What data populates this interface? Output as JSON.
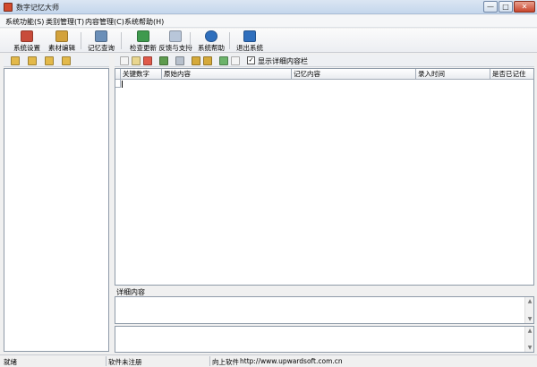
{
  "window": {
    "title": "数字记忆大师"
  },
  "window_controls": {
    "minimize": "—",
    "maximize": "□",
    "close": "✕"
  },
  "menu": [
    {
      "label": "系统功能(S)"
    },
    {
      "label": "类别管理(T)"
    },
    {
      "label": "内容管理(C)"
    },
    {
      "label": "系统帮助(H)"
    }
  ],
  "toolbar": {
    "items": [
      {
        "label": "系统设置",
        "icon": "settings-icon",
        "color": "#c84b3a"
      },
      {
        "label": "素材编辑",
        "icon": "edit-icon",
        "color": "#d3a23b"
      },
      {
        "label": "记忆查询",
        "icon": "document-search-icon",
        "color": "#6b8fb8"
      },
      {
        "label": "检查更新",
        "icon": "globe-update-icon",
        "color": "#3f9a4e"
      },
      {
        "label": "反馈与支持",
        "icon": "mail-icon",
        "color": "#b8c6d9"
      },
      {
        "label": "系统帮助",
        "icon": "help-icon",
        "color": "#2f6fbd"
      },
      {
        "label": "退出系统",
        "icon": "exit-icon",
        "color": "#2f6fbd"
      }
    ]
  },
  "category_toolbar": {
    "icons": [
      "add-folder-icon",
      "folder-icon",
      "edit-folder-icon",
      "delete-folder-icon"
    ],
    "color": "#e3b94a"
  },
  "content_toolbar": {
    "icons": [
      "new-icon",
      "edit-icon",
      "delete-icon",
      "save-icon",
      "print-icon",
      "import-icon",
      "export-icon",
      "refresh-icon",
      "notes-icon"
    ],
    "show_detail_checked": true,
    "show_detail_label": "显示详细内容栏",
    "check_mark": "✓"
  },
  "grid": {
    "columns": [
      "关键数字",
      "原始内容",
      "记忆内容",
      "录入时间",
      "是否已记住"
    ]
  },
  "detail": {
    "label": "详细内容",
    "scroll_up": "▲",
    "scroll_down": "▼"
  },
  "statusbar": {
    "state": "就绪",
    "registration": "软件未注册",
    "company": "向上软件",
    "website": "http://www.upwardsoft.com.cn"
  }
}
